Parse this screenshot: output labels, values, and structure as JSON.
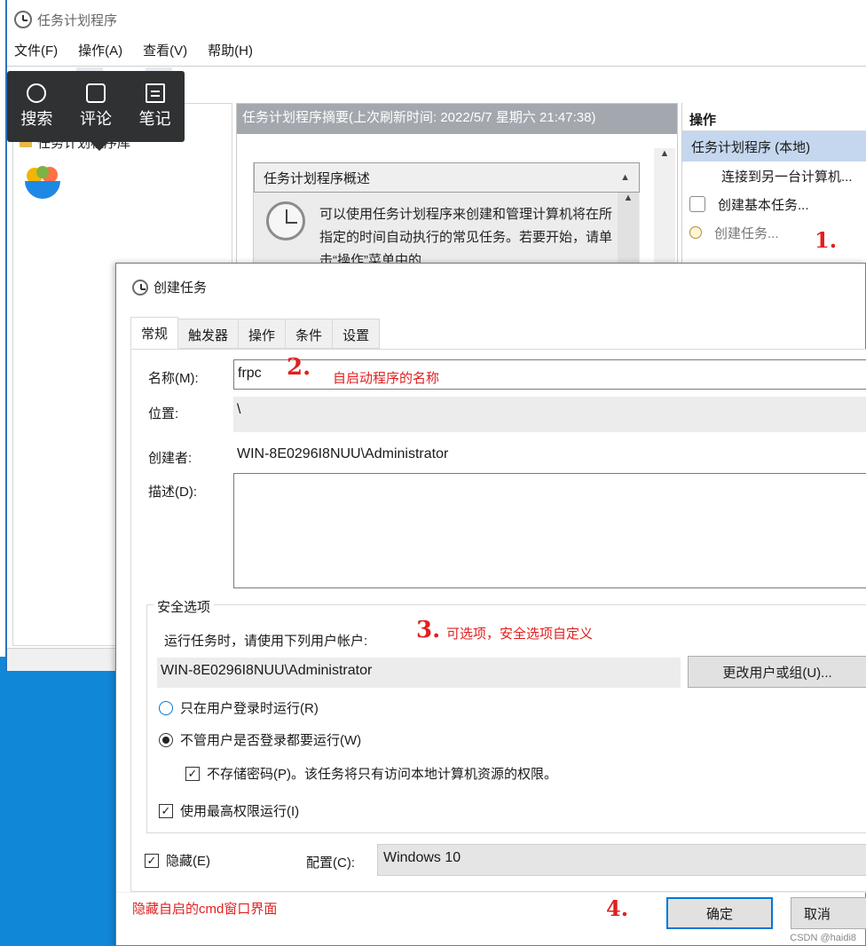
{
  "main_window": {
    "title": "任务计划程序",
    "menu": [
      "文件(F)",
      "操作(A)",
      "查看(V)",
      "帮助(H)"
    ],
    "tree_item": "任务计划程序库",
    "summary_header": "任务计划程序摘要(上次刷新时间: 2022/5/7 星期六 21:47:38)",
    "overview_title": "任务计划程序概述",
    "overview_text": "可以使用任务计划程序来创建和管理计算机将在所指定的时间自动执行的常见任务。若要开始，请单击“操作”菜单中的",
    "actions": {
      "header": "操作",
      "section": "任务计划程序 (本地)",
      "items": [
        "连接到另一台计算机...",
        "创建基本任务...",
        "创建任务..."
      ]
    }
  },
  "float_toolbar": {
    "items": [
      {
        "label": "搜索",
        "icon": "search-icon"
      },
      {
        "label": "评论",
        "icon": "comment-icon"
      },
      {
        "label": "笔记",
        "icon": "note-icon"
      }
    ]
  },
  "dialog": {
    "title": "创建任务",
    "tabs": [
      "常规",
      "触发器",
      "操作",
      "条件",
      "设置"
    ],
    "name_label": "名称(M):",
    "name_value": "frpc",
    "location_label": "位置:",
    "location_value": "\\",
    "author_label": "创建者:",
    "author_value": "WIN-8E0296I8NUU\\Administrator",
    "description_label": "描述(D):",
    "security": {
      "legend": "安全选项",
      "run_as_label": "运行任务时，请使用下列用户帐户:",
      "user_value": "WIN-8E0296I8NUU\\Administrator",
      "change_user_button": "更改用户或组(U)...",
      "radio_logged_on": "只在用户登录时运行(R)",
      "radio_always": "不管用户是否登录都要运行(W)",
      "radio_selected": "always",
      "no_store_password": "不存储密码(P)。该任务将只有访问本地计算机资源的权限。",
      "no_store_password_checked": true,
      "highest_privileges": "使用最高权限运行(I)",
      "highest_privileges_checked": true
    },
    "hidden_label": "隐藏(E)",
    "hidden_checked": true,
    "configure_label": "配置(C):",
    "configure_value": "Windows 10",
    "ok_button": "确定",
    "cancel_button": "取消"
  },
  "annotations": {
    "n1": "1.",
    "n2": "2.",
    "n2_text": "自启动程序的名称",
    "n3": "3.",
    "n3_text": "可选项，安全选项自定义",
    "n4": "4.",
    "hidden_note": "隐藏自启的cmd窗口界面"
  },
  "watermark": "CSDN @haidi8",
  "colors": {
    "desktop": "#1187d8",
    "annotation": "#e02020",
    "actions_selected": "#c5d7ee",
    "primary_border": "#0078d7"
  }
}
